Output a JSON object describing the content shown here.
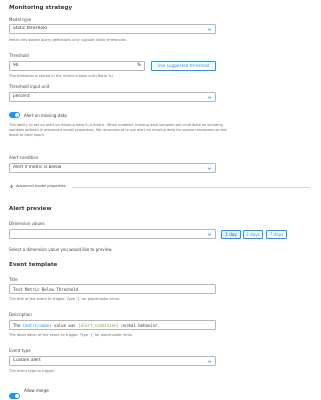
{
  "monitoring": {
    "title": "Monitoring strategy",
    "model_type_label": "Model type",
    "model_type_value": "Static threshold",
    "model_type_hint": "Metric key-based query definitions only support static thresholds.",
    "threshold_label": "Threshold",
    "threshold_value": "90",
    "threshold_unit": "%",
    "suggest_button": "Use suggested threshold",
    "threshold_hint": "The threshold is stored in the metric's base unit (Ratio %)",
    "input_unit_label": "Threshold input unit",
    "input_unit_value": "percent",
    "missing_data_label": "Alert on missing data",
    "missing_data_hint": "The ability to set an alert on missing data in a metric. When enabled, missing data samples will contribute as violating samples defined in advanced model properties. We recommend to not alert on missing data for sparse timeseries as this leads to alert spam.",
    "condition_label": "Alert condition",
    "condition_value": "Alert if metric is below",
    "advanced_label": "Advanced model properties"
  },
  "preview": {
    "title": "Alert preview",
    "dimension_label": "Dimension values",
    "dimension_value": "",
    "ranges": [
      "1 day",
      "3 days",
      "7 days"
    ],
    "active_range_index": 0,
    "select_hint": "Select a dimension value you would like to preview."
  },
  "event": {
    "title": "Event template",
    "title_label": "Title",
    "title_value": "Test Metric Below Threshold",
    "title_hint": "The title of the event to trigger. Type '{' for placeholder hints.",
    "description_label": "Description",
    "description_prefix": "The ",
    "description_ph1": "{metricname}",
    "description_mid": " value was ",
    "description_ph2": "{alert_condition}",
    "description_suffix": " normal behavior.",
    "description_hint": "The description of the event to trigger. Type '{' for placeholder hints.",
    "type_label": "Event type",
    "type_value": "Custom alert",
    "type_hint": "The event type to trigger.",
    "merge_label": "Allow merge"
  }
}
